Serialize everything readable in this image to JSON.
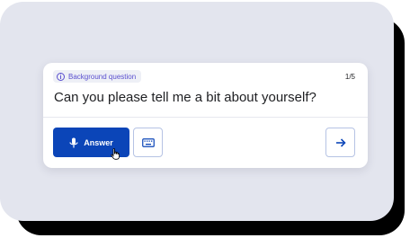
{
  "card": {
    "tag_label": "Background question",
    "counter": "1/5",
    "question": "Can you please tell me a bit about yourself?"
  },
  "actions": {
    "answer_label": "Answer"
  },
  "colors": {
    "primary": "#0b45b8",
    "tag_text": "#5a4fcf",
    "backdrop": "#e3e5ee"
  },
  "icons": [
    "info-icon",
    "microphone-icon",
    "keyboard-icon",
    "arrow-right-icon",
    "pointer-cursor-icon"
  ]
}
